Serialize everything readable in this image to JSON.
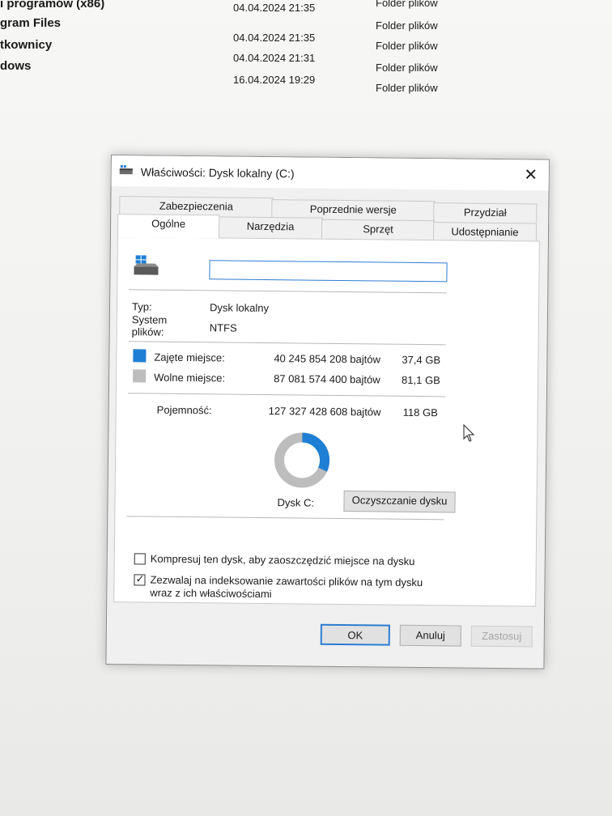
{
  "explorer": {
    "rows": [
      {
        "name": "i programów (x86)",
        "date": "04.04.2024 21:35",
        "type": "Folder plików"
      },
      {
        "name": "gram Files",
        "date": "04.04.2024 21:35",
        "type": "Folder plików"
      },
      {
        "name": "tkownicy",
        "date": "04.04.2024 21:31",
        "type": "Folder plików"
      },
      {
        "name": "dows",
        "date": "16.04.2024 19:29",
        "type": "Folder plików"
      }
    ],
    "extra_type": "Folder plików"
  },
  "dialog": {
    "title": "Właściwości: Dysk lokalny (C:)",
    "close_glyph": "✕",
    "tabs": {
      "zabezpieczenia": "Zabezpieczenia",
      "poprzednie": "Poprzednie wersje",
      "przydzial": "Przydział",
      "ogolne": "Ogólne",
      "narzedzia": "Narzędzia",
      "sprzet": "Sprzęt",
      "udostepnianie": "Udostępnianie"
    },
    "name_input": {
      "value": ""
    },
    "info": {
      "typ_label": "Typ:",
      "typ_value": "Dysk lokalny",
      "fs_label_1": "System",
      "fs_label_2": "plików:",
      "fs_value": "NTFS"
    },
    "used": {
      "label": "Zajęte miejsce:",
      "bytes": "40 245 854 208 bajtów",
      "size": "37,4 GB",
      "color": "#1f7fd4"
    },
    "free": {
      "label": "Wolne miejsce:",
      "bytes": "87 081 574 400 bajtów",
      "size": "81,1 GB",
      "color": "#bdbdbd"
    },
    "capacity": {
      "label": "Pojemność:",
      "bytes": "127 327 428 608 bajtów",
      "size": "118 GB"
    },
    "usage_fraction": 0.316,
    "drive_label": "Dysk C:",
    "cleanup_button": "Oczyszczanie dysku",
    "compress_checkbox": {
      "label": "Kompresuj ten dysk, aby zaoszczędzić miejsce na dysku",
      "checked": false
    },
    "index_checkbox": {
      "label_1": "Zezwalaj na indeksowanie zawartości plików na tym dysku",
      "label_2": "wraz z ich właściwościami",
      "checked": true
    },
    "buttons": {
      "ok": "OK",
      "cancel": "Anuluj",
      "apply": "Zastosuj"
    }
  }
}
